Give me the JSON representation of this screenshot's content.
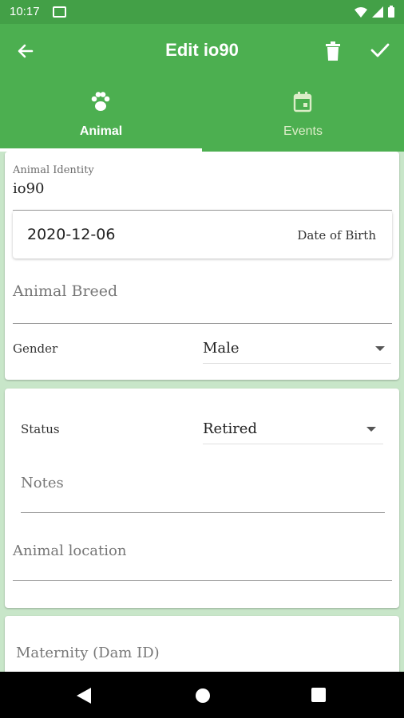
{
  "status_bar": {
    "time": "10:17"
  },
  "header": {
    "title": "Edit io90"
  },
  "tabs": [
    {
      "label": "Animal",
      "icon": "paw-icon",
      "selected": true
    },
    {
      "label": "Events",
      "icon": "calendar-icon",
      "selected": false
    }
  ],
  "identity": {
    "label": "Animal Identity",
    "value": "io90"
  },
  "dob": {
    "value": "2020-12-06",
    "label": "Date of Birth"
  },
  "breed": {
    "placeholder": "Animal Breed"
  },
  "gender": {
    "label": "Gender",
    "value": "Male"
  },
  "status": {
    "label": "Status",
    "value": "Retired"
  },
  "notes": {
    "placeholder": "Notes"
  },
  "location": {
    "placeholder": "Animal location"
  },
  "maternity": {
    "placeholder": "Maternity (Dam ID)"
  },
  "colors": {
    "primary": "#4caf50",
    "status_bar": "#43a047",
    "background": "#c8e6c9"
  }
}
